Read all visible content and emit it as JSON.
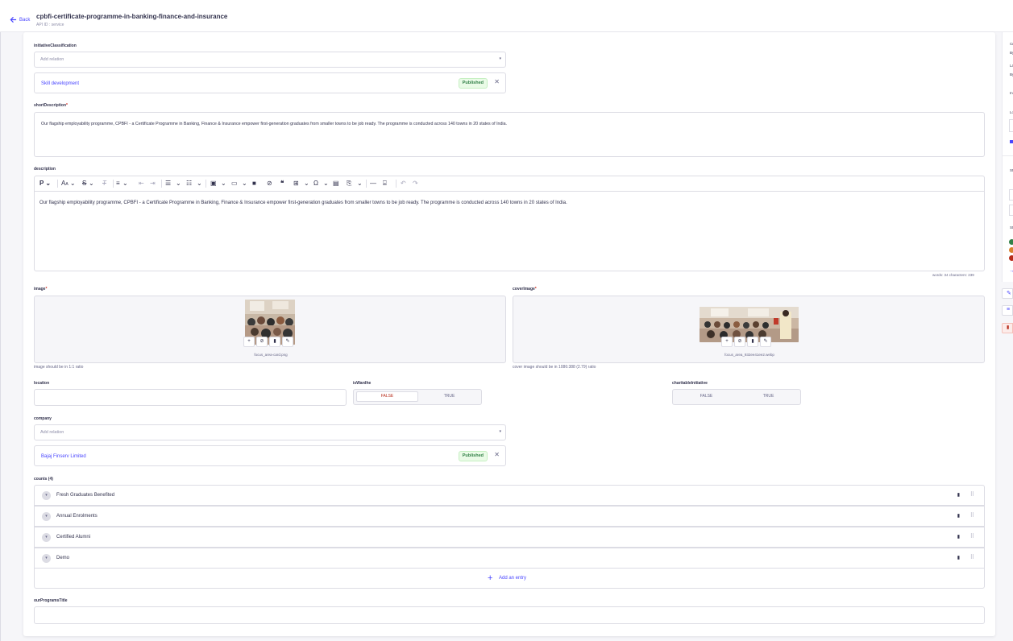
{
  "header": {
    "back_label": "Back",
    "title": "cpbfi-certificate-programme-in-banking-finance-and-insurance",
    "subtitle": "API ID : service"
  },
  "fields": {
    "initiative_classification": {
      "label": "initiativeClassification",
      "placeholder": "Add relation",
      "relation": {
        "name": "Skill development",
        "status": "Published"
      }
    },
    "short_description": {
      "label": "shortDescription",
      "required_mark": "*",
      "value": "Our flagship employability programme, CPBFI - a Certificate Programme in Banking, Finance & Insurance empower first-generation graduates from smaller towns to be job ready. The programme is conducted across 140 towns in 20 states of India."
    },
    "description": {
      "label": "description",
      "value": "Our flagship employability programme, CPBFI - a Certificate Programme in Banking, Finance & Insurance empower first-generation graduates from smaller towns to be job ready. The programme is conducted across 140 towns in 20 states of India.",
      "word_count": "words: 34  characters: 239",
      "toolbar": {
        "paragraph": "P",
        "font_size": "A",
        "strikethrough": "S",
        "clear_format": "T",
        "table_icon": "table-icon",
        "omega": "Ω"
      }
    },
    "image": {
      "label": "image",
      "required_mark": "*",
      "filename": "focus_area-card.png",
      "hint": "image should be in 1:1 ratio"
    },
    "cover_image": {
      "label": "coverImage",
      "required_mark": "*",
      "filename": "focus_area_932ee41ee2.webp",
      "hint": "cover image should be in 1086:388 (2.79) ratio"
    },
    "location": {
      "label": "location",
      "value": ""
    },
    "is_ward_he": {
      "label": "isWardhe",
      "false_label": "FALSE",
      "true_label": "TRUE",
      "selected": "FALSE"
    },
    "charitable_initiative": {
      "label": "charitableInitiative",
      "false_label": "FALSE",
      "true_label": "TRUE",
      "selected": null
    },
    "company": {
      "label": "company",
      "placeholder": "Add relation",
      "relation": {
        "name": "Bajaj Finserv Limited",
        "status": "Published"
      }
    },
    "counts": {
      "label": "counts (4)",
      "entries": [
        "Fresh Graduates Benefited",
        "Annual Enrolments",
        "Certified Alumni",
        "Demo"
      ],
      "add_label": "Add an entry"
    },
    "our_programs_title": {
      "label": "ourProgramsTitle",
      "value": ""
    }
  },
  "colors": {
    "primary": "#4945ff",
    "published": "#328048",
    "false_active": "#b72b1a",
    "status_dots": [
      "#328048",
      "#d9822f",
      "#b72b1a"
    ]
  },
  "right_panel": {
    "rows": [
      "Cr",
      "By",
      "La",
      "By",
      "In",
      "Lo",
      "St",
      "St"
    ]
  }
}
